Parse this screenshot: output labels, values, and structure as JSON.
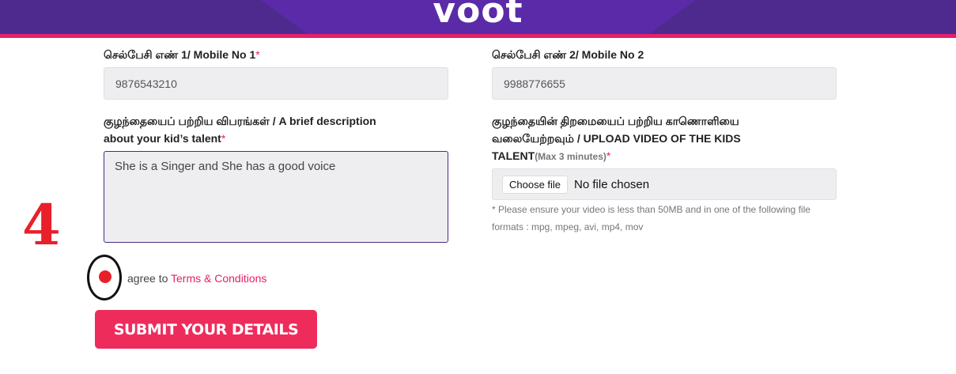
{
  "header": {
    "logo_text": "voot"
  },
  "form": {
    "mobile1": {
      "label": "செல்பேசி எண் 1/ Mobile No 1",
      "required_mark": "*",
      "value": "9876543210"
    },
    "mobile2": {
      "label": "செல்பேசி எண் 2/ Mobile No 2",
      "value": "9988776655"
    },
    "description": {
      "label_line1": "குழந்தையைப் பற்றிய விபரங்கள் / A brief description",
      "label_line2": "about your kid’s talent",
      "required_mark": "*",
      "value": "She is a Singer and She has a good voice"
    },
    "video": {
      "label_line1": "குழந்தையின் திறமையைப் பற்றிய காணொளியை",
      "label_line2": "வலையேற்றவும் / UPLOAD VIDEO OF THE KIDS",
      "label_line3": "TALENT",
      "hint": "(Max 3 minutes)",
      "required_mark": "*",
      "choose_button": "Choose file",
      "file_status": "No file chosen",
      "note_line1": "* Please ensure your video is less than 50MB and in one of the following file",
      "note_line2": "formats : mpg, mpeg, avi, mp4, mov"
    },
    "terms": {
      "prefix": "agree to",
      "link": "Terms & Conditions"
    },
    "submit_label": "SUBMIT YOUR DETAILS"
  },
  "annotation": {
    "step_number": "4"
  },
  "colors": {
    "brand_purple": "#4e2a8e",
    "accent_pink": "#e5206a",
    "annotation_red": "#e8202a"
  }
}
